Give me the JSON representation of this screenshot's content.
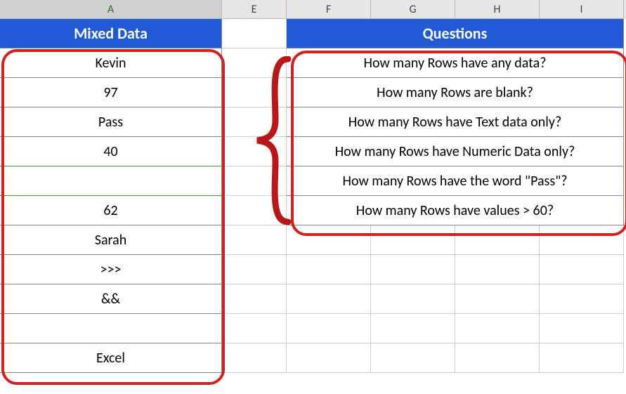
{
  "column_headers": {
    "A": "A",
    "E": "E",
    "F": "F",
    "G": "G",
    "H": "H",
    "I": "I"
  },
  "headers": {
    "mixed_data": "Mixed Data",
    "questions": "Questions"
  },
  "mixed_data": [
    "Kevin",
    "97",
    "Pass",
    "40",
    "",
    "62",
    "Sarah",
    ">>>",
    "&&",
    "",
    "Excel"
  ],
  "questions": [
    "How many Rows have any data?",
    "How many Rows are blank?",
    "How many Rows have Text data only?",
    "How many Rows have Numeric Data only?",
    "How many Rows have the word \"Pass\"?",
    "How many Rows have values > 60?"
  ],
  "chart_data": {
    "type": "table",
    "tables": [
      {
        "title": "Mixed Data",
        "column": "A",
        "rows": [
          "Kevin",
          "97",
          "Pass",
          "40",
          "",
          "62",
          "Sarah",
          ">>>",
          "&&",
          "",
          "Excel"
        ]
      },
      {
        "title": "Questions",
        "columns": "F:I",
        "rows": [
          "How many Rows have any data?",
          "How many Rows are blank?",
          "How many Rows have Text data only?",
          "How many Rows have Numeric Data only?",
          "How many Rows have the word \"Pass\"?",
          "How many Rows have values > 60?"
        ]
      }
    ]
  }
}
